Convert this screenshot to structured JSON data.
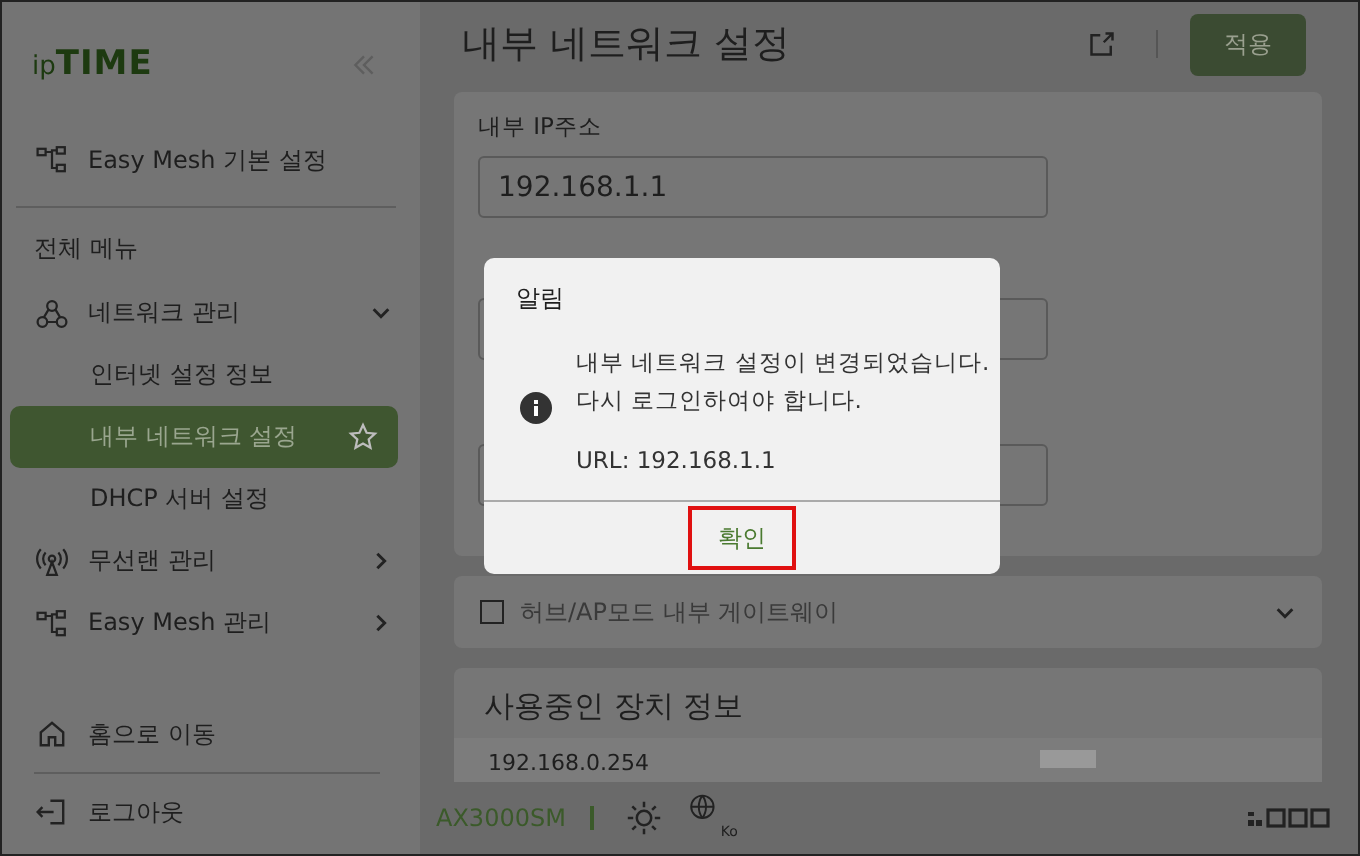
{
  "sidebar": {
    "logo": "ip**TIME**",
    "pinned": {
      "label": "Easy Mesh 기본 설정",
      "kind": "mesh"
    },
    "section": "전체 메뉴",
    "menu": [
      {
        "label": "네트워크 관리",
        "kind": "network",
        "expanded": true,
        "children": [
          {
            "label": "인터넷 설정 정보",
            "selected": false
          },
          {
            "label": "내부 네트워크 설정",
            "selected": true
          },
          {
            "label": "DHCP 서버 설정",
            "selected": false
          }
        ]
      },
      {
        "label": "무선랜 관리",
        "kind": "wireless",
        "expanded": false
      },
      {
        "label": "Easy Mesh 관리",
        "kind": "mesh",
        "expanded": false
      }
    ],
    "footer": [
      {
        "label": "홈으로 이동",
        "kind": "home"
      },
      {
        "label": "로그아웃",
        "kind": "logout"
      }
    ]
  },
  "header": {
    "title": "내부 네트워크 설정",
    "apply": "적용"
  },
  "settings": {
    "field": {
      "label": "내부 IP주소",
      "value": "192.168.1.1"
    },
    "checkbox": {
      "label": "허브/AP모드 내부 게이트웨이",
      "checked": false
    }
  },
  "devices": {
    "title": "사용중인 장치 정보",
    "rows": [
      {
        "ip": "192.168.0.254"
      }
    ]
  },
  "status_bar": {
    "model": "AX3000SM",
    "language": "Ko"
  },
  "dialog": {
    "title": "알림",
    "lines": [
      "내부 네트워크 설정이 변경되었습니다.",
      "다시 로그인하여야 합니다."
    ],
    "url": "URL: 192.168.1.1",
    "confirm": {
      "label": "확인",
      "highlighted": true
    }
  }
}
